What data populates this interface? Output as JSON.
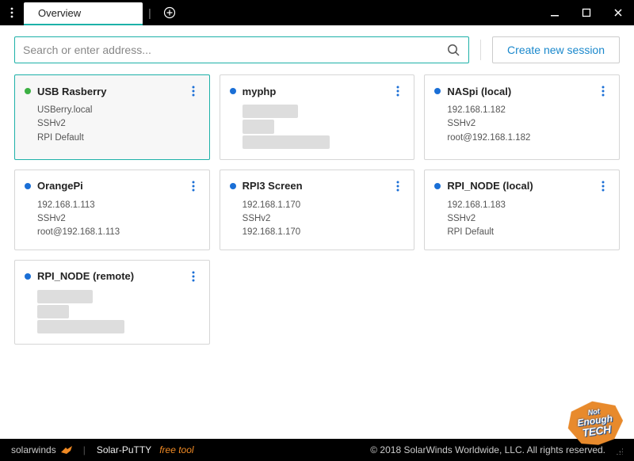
{
  "titlebar": {
    "tab_label": "Overview"
  },
  "toolbar": {
    "search_placeholder": "Search or enter address...",
    "new_session_label": "Create new session"
  },
  "cards": [
    {
      "name": "USB Rasberry",
      "status": "green",
      "active": true,
      "lines": [
        "USBerry.local",
        "SSHv2",
        "RPI Default"
      ],
      "redacted": false
    },
    {
      "name": "myphp",
      "status": "blue",
      "active": false,
      "lines": [
        "",
        "",
        ""
      ],
      "redacted": true
    },
    {
      "name": "NASpi (local)",
      "status": "blue",
      "active": false,
      "lines": [
        "192.168.1.182",
        "SSHv2",
        "root@192.168.1.182"
      ],
      "redacted": false
    },
    {
      "name": "OrangePi",
      "status": "blue",
      "active": false,
      "lines": [
        "192.168.1.113",
        "SSHv2",
        "root@192.168.1.113"
      ],
      "redacted": false
    },
    {
      "name": "RPI3 Screen",
      "status": "blue",
      "active": false,
      "lines": [
        "192.168.1.170",
        "SSHv2",
        "192.168.1.170"
      ],
      "redacted": false
    },
    {
      "name": "RPI_NODE (local)",
      "status": "blue",
      "active": false,
      "lines": [
        "192.168.1.183",
        "SSHv2",
        "RPI Default"
      ],
      "redacted": false
    },
    {
      "name": "RPI_NODE (remote)",
      "status": "blue",
      "active": false,
      "lines": [
        "",
        "",
        ""
      ],
      "redacted": true
    }
  ],
  "statusbar": {
    "brand": "solarwinds",
    "app": "Solar-PuTTY",
    "app_suffix": "free tool",
    "copyright": "© 2018 SolarWinds Worldwide, LLC. All rights reserved."
  },
  "watermark": {
    "line1": "Not",
    "line2": "Enough",
    "line3": "TECH"
  },
  "colors": {
    "accent": "#1db1a8",
    "link": "#1a88cc"
  }
}
